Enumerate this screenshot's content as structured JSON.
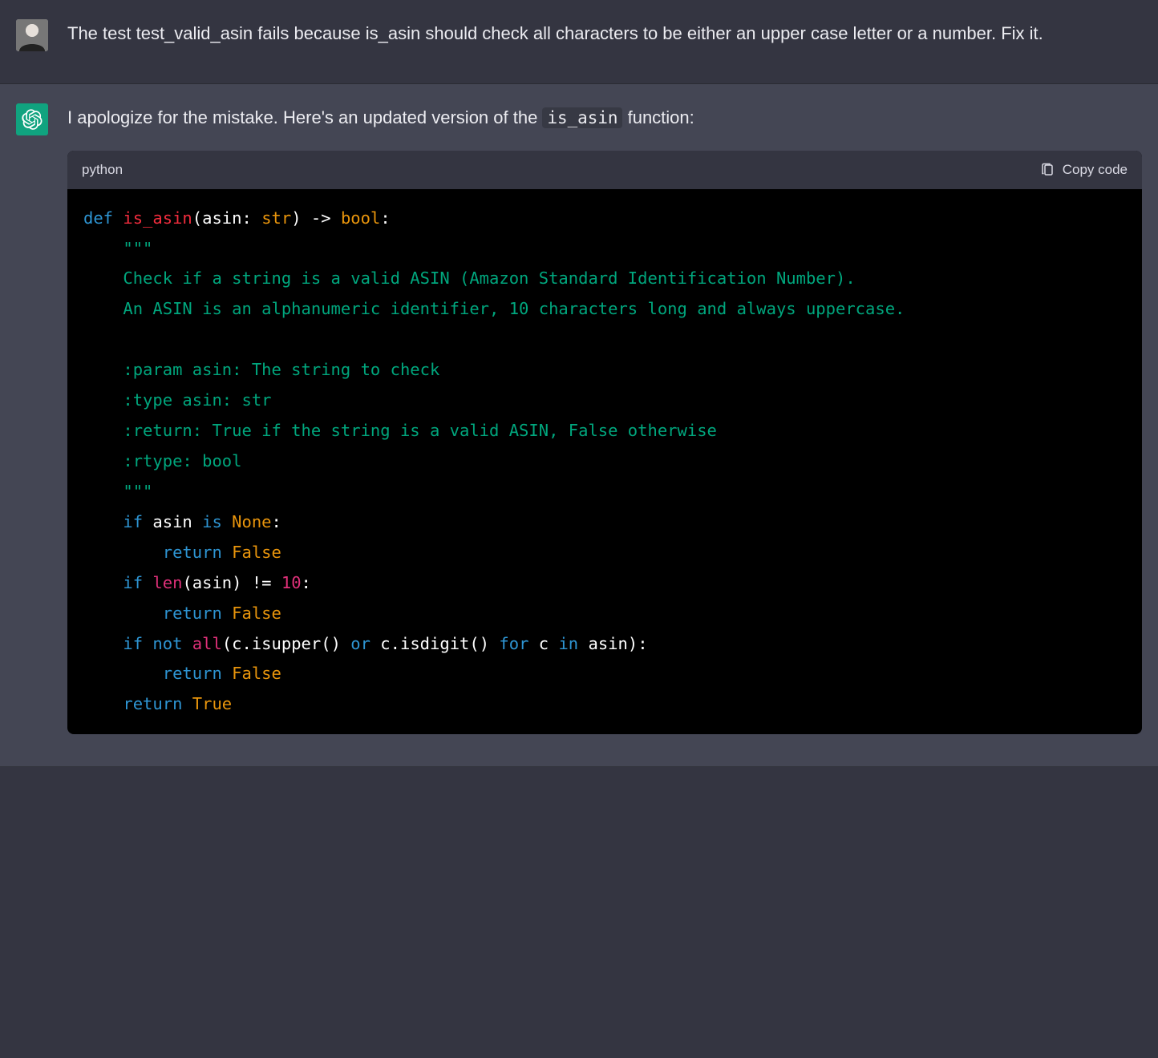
{
  "messages": {
    "user": {
      "text": "The test test_valid_asin fails because is_asin should check all characters to be either an upper case letter or a number. Fix it."
    },
    "assistant": {
      "text_before": "I apologize for the mistake. Here's an updated version of the ",
      "inline_code": "is_asin",
      "text_after": " function:"
    }
  },
  "code_block": {
    "language": "python",
    "copy_label": "Copy code",
    "tokens": [
      [
        [
          "kw",
          "def"
        ],
        [
          "pu",
          " "
        ],
        [
          "fn",
          "is_asin"
        ],
        [
          "pu",
          "("
        ],
        [
          "nm",
          "asin: "
        ],
        [
          "ty",
          "str"
        ],
        [
          "pu",
          ") -> "
        ],
        [
          "ty",
          "bool"
        ],
        [
          "pu",
          ":"
        ]
      ],
      [
        [
          "pu",
          "    "
        ],
        [
          "doc",
          "\"\"\""
        ]
      ],
      [
        [
          "doc",
          "    Check if a string is a valid ASIN (Amazon Standard Identification Number)."
        ]
      ],
      [
        [
          "doc",
          "    An ASIN is an alphanumeric identifier, 10 characters long and always uppercase."
        ]
      ],
      [
        [
          "doc",
          ""
        ]
      ],
      [
        [
          "doc",
          "    :param asin: The string to check"
        ]
      ],
      [
        [
          "doc",
          "    :type asin: str"
        ]
      ],
      [
        [
          "doc",
          "    :return: True if the string is a valid ASIN, False otherwise"
        ]
      ],
      [
        [
          "doc",
          "    :rtype: bool"
        ]
      ],
      [
        [
          "doc",
          "    \"\"\""
        ]
      ],
      [
        [
          "pu",
          "    "
        ],
        [
          "kw",
          "if"
        ],
        [
          "nm",
          " asin "
        ],
        [
          "kw",
          "is"
        ],
        [
          "pu",
          " "
        ],
        [
          "lp",
          "None"
        ],
        [
          "pu",
          ":"
        ]
      ],
      [
        [
          "pu",
          "        "
        ],
        [
          "kw",
          "return"
        ],
        [
          "pu",
          " "
        ],
        [
          "lp",
          "False"
        ]
      ],
      [
        [
          "pu",
          "    "
        ],
        [
          "kw",
          "if"
        ],
        [
          "pu",
          " "
        ],
        [
          "bi",
          "len"
        ],
        [
          "pu",
          "(asin) != "
        ],
        [
          "num",
          "10"
        ],
        [
          "pu",
          ":"
        ]
      ],
      [
        [
          "pu",
          "        "
        ],
        [
          "kw",
          "return"
        ],
        [
          "pu",
          " "
        ],
        [
          "lp",
          "False"
        ]
      ],
      [
        [
          "pu",
          "    "
        ],
        [
          "kw",
          "if"
        ],
        [
          "pu",
          " "
        ],
        [
          "kw",
          "not"
        ],
        [
          "pu",
          " "
        ],
        [
          "bi",
          "all"
        ],
        [
          "pu",
          "(c.isupper() "
        ],
        [
          "kw",
          "or"
        ],
        [
          "pu",
          " c.isdigit() "
        ],
        [
          "kw",
          "for"
        ],
        [
          "pu",
          " c "
        ],
        [
          "kw",
          "in"
        ],
        [
          "pu",
          " asin):"
        ]
      ],
      [
        [
          "pu",
          "        "
        ],
        [
          "kw",
          "return"
        ],
        [
          "pu",
          " "
        ],
        [
          "lp",
          "False"
        ]
      ],
      [
        [
          "pu",
          "    "
        ],
        [
          "kw",
          "return"
        ],
        [
          "pu",
          " "
        ],
        [
          "lp",
          "True"
        ]
      ]
    ]
  }
}
